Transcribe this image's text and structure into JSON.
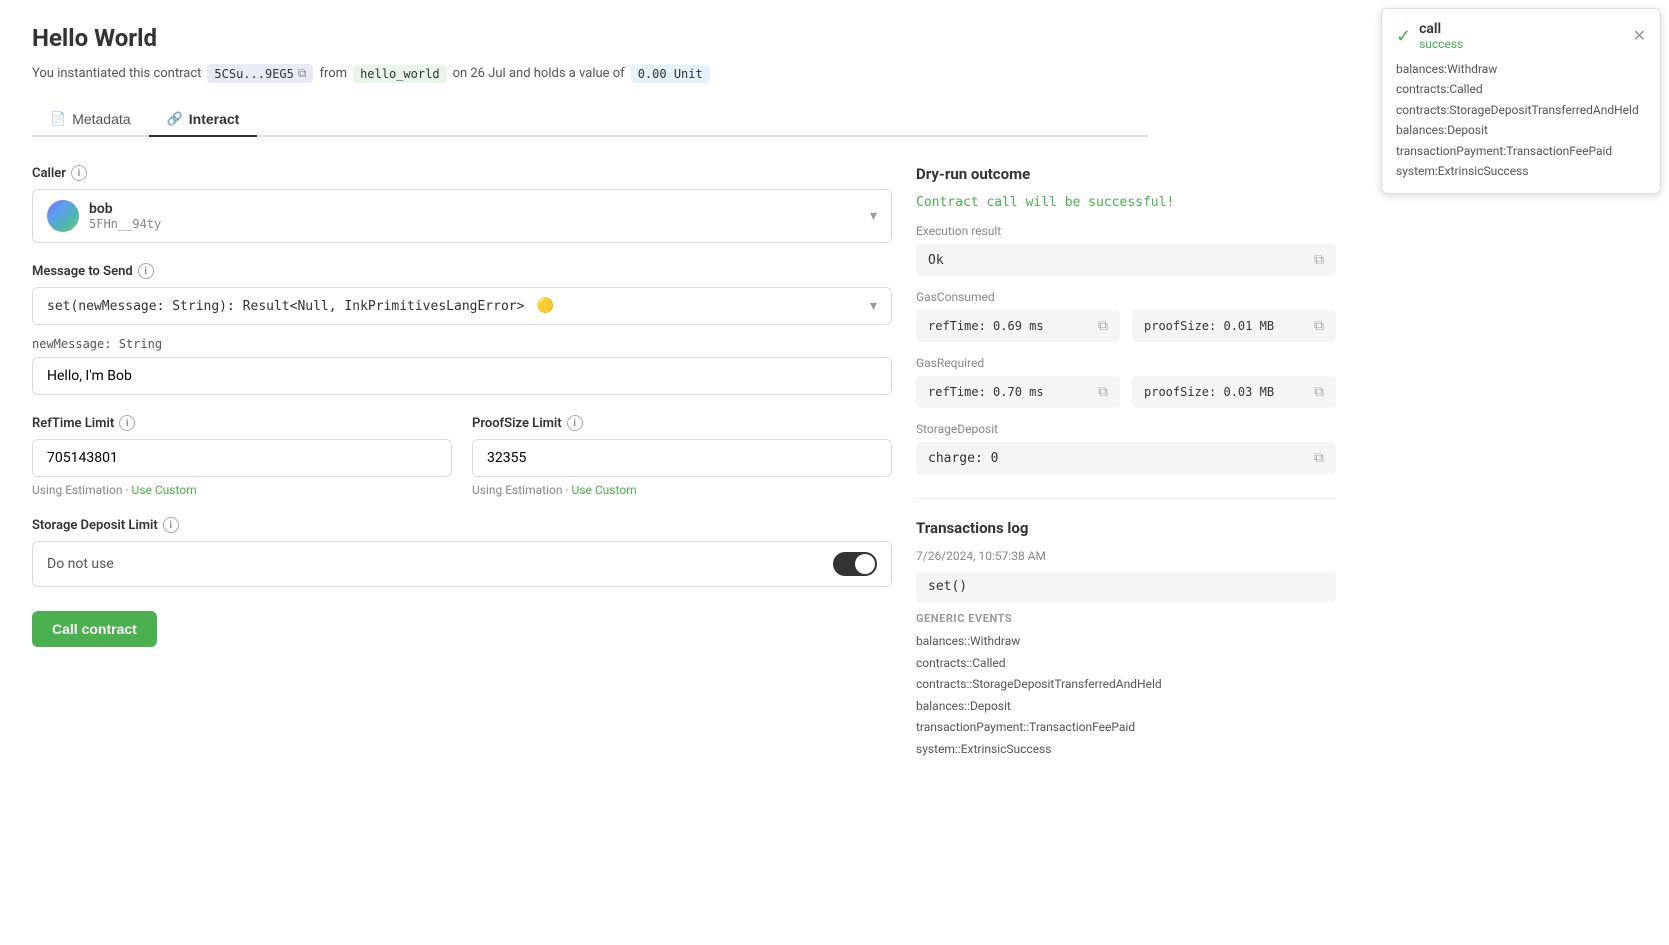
{
  "page": {
    "title": "Hello World",
    "subtitle": {
      "prefix": "You instantiated this contract",
      "address": "5CSu...9EG5",
      "from_label": "from",
      "contract_name": "hello_world",
      "date_label": "on 26 Jul and holds a value of",
      "value": "0.00 Unit"
    }
  },
  "tabs": [
    {
      "id": "metadata",
      "label": "Metadata",
      "icon": "📄"
    },
    {
      "id": "interact",
      "label": "Interact",
      "icon": "🔗",
      "active": true
    }
  ],
  "caller": {
    "label": "Caller",
    "name": "bob",
    "address": "5FHn__94ty"
  },
  "message": {
    "label": "Message to Send",
    "value": "set(newMessage: String): Result<Null, InkPrimitivesLangError>",
    "icon": "🟡"
  },
  "params": [
    {
      "label": "newMessage: String",
      "value": "Hello, I'm Bob"
    }
  ],
  "refTimeLimit": {
    "label": "RefTime Limit",
    "value": "705143801",
    "estimation": "Using Estimation · ",
    "use_custom": "Use Custom"
  },
  "proofSizeLimit": {
    "label": "ProofSize Limit",
    "value": "32355",
    "estimation": "Using Estimation · ",
    "use_custom": "Use Custom"
  },
  "storageDepositLimit": {
    "label": "Storage Deposit Limit",
    "placeholder": "Do not use",
    "toggle_on": true
  },
  "callButton": {
    "label": "Call contract"
  },
  "dryRun": {
    "title": "Dry-run outcome",
    "success_text": "Contract call will be successful!",
    "executionResult": {
      "label": "Execution result",
      "value": "Ok"
    },
    "gasConsumed": {
      "label": "GasConsumed",
      "refTime": "refTime: 0.69 ms",
      "proofSize": "proofSize: 0.01 MB"
    },
    "gasRequired": {
      "label": "GasRequired",
      "refTime": "refTime: 0.70 ms",
      "proofSize": "proofSize: 0.03 MB"
    },
    "storageDeposit": {
      "label": "StorageDeposit",
      "value": "charge: 0"
    }
  },
  "transactionsLog": {
    "title": "Transactions log",
    "timestamp": "7/26/2024, 10:57:38 AM",
    "call": "set()",
    "genericEventsLabel": "GENERIC EVENTS",
    "events": [
      "balances::Withdraw",
      "contracts::Called",
      "contracts::StorageDepositTransferredAndHeld",
      "balances::Deposit",
      "transactionPayment::TransactionFeePaid",
      "system::ExtrinsicSuccess"
    ]
  },
  "notification": {
    "title": "call",
    "status": "success",
    "events": [
      "balances:Withdraw",
      "contracts:Called",
      "contracts:StorageDepositTransferredAndHeld",
      "balances:Deposit",
      "transactionPayment:TransactionFeePaid",
      "system:ExtrinsicSuccess"
    ]
  }
}
